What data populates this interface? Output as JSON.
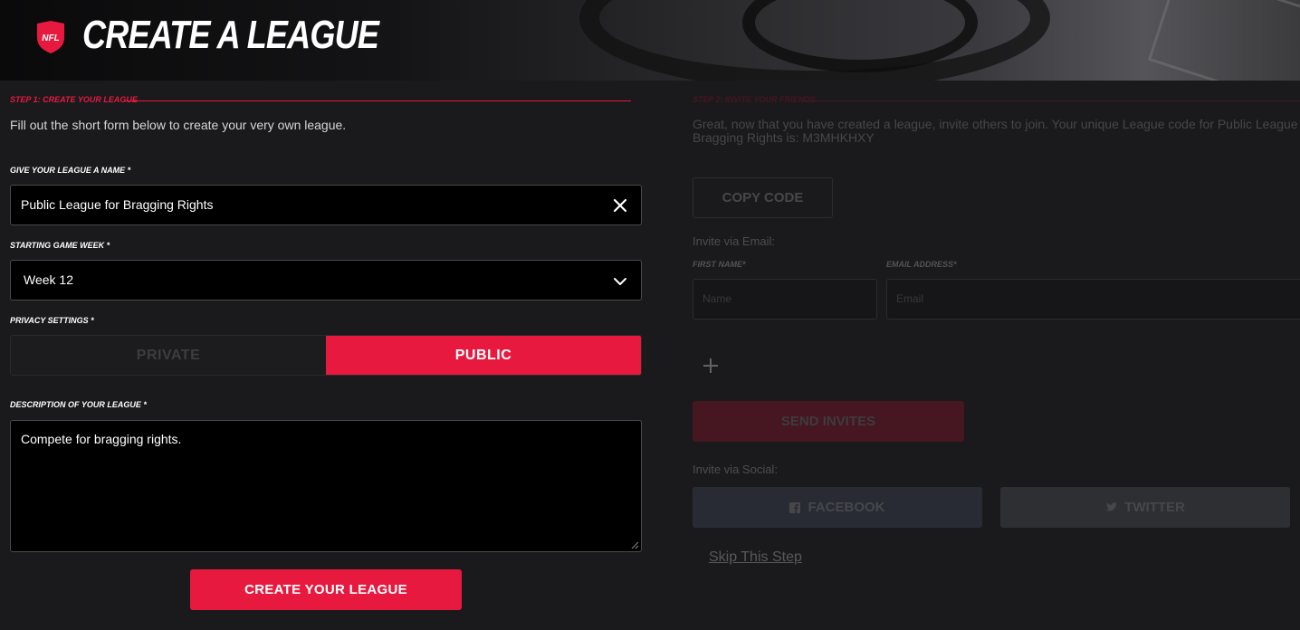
{
  "header": {
    "title": "CREATE A LEAGUE",
    "logo_text": "NFL"
  },
  "step1": {
    "label": "STEP 1: CREATE YOUR LEAGUE",
    "intro": "Fill out the short form below to create your very own league.",
    "name_label": "GIVE YOUR LEAGUE A NAME *",
    "name_value": "Public League for Bragging Rights",
    "week_label": "STARTING GAME WEEK *",
    "week_value": "Week 12",
    "privacy_label": "PRIVACY SETTINGS *",
    "privacy_options": [
      "PRIVATE",
      "PUBLIC"
    ],
    "privacy_selected": "PUBLIC",
    "description_label": "DESCRIPTION OF YOUR LEAGUE *",
    "description_value": "Compete for bragging rights.",
    "submit_label": "CREATE YOUR LEAGUE"
  },
  "step2": {
    "label": "STEP 2: INVITE YOUR FRIENDS",
    "intro_line1": "Great, now that you have created a league, invite others to join. Your unique League code for Public League fo",
    "intro_line2": "Bragging Rights is: M3MHKHXY",
    "copy_label": "COPY CODE",
    "invite_email_label": "Invite via Email:",
    "first_name_label": "FIRST NAME*",
    "first_name_placeholder": "Name",
    "email_label": "EMAIL ADDRESS*",
    "email_placeholder": "Email",
    "send_label": "SEND INVITES",
    "invite_social_label": "Invite via Social:",
    "facebook_label": "FACEBOOK",
    "twitter_label": "TWITTER",
    "skip_label": "Skip This Step"
  },
  "colors": {
    "accent": "#e8193f",
    "background": "#1a1a1c",
    "input_bg": "#000000"
  }
}
